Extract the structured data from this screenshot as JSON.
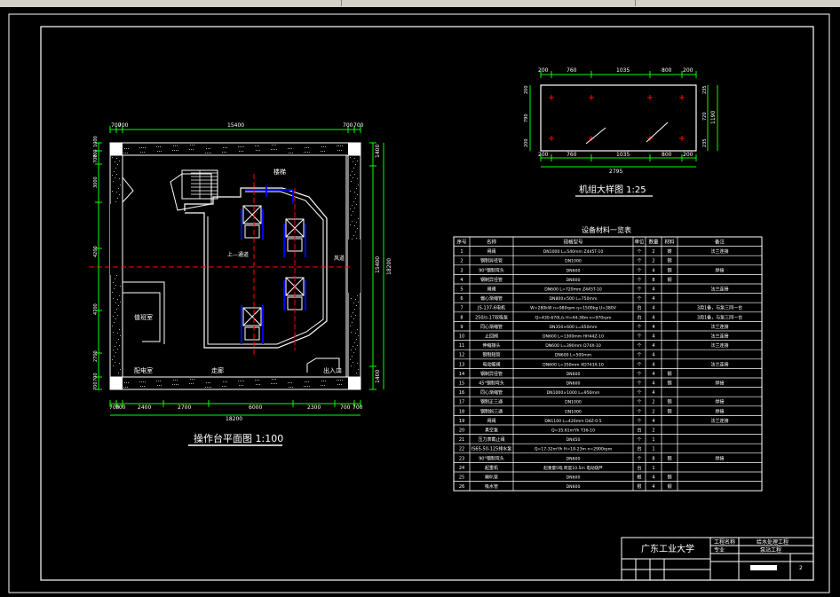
{
  "plan": {
    "title": "操作台平面图 1:100",
    "top_dims": [
      "700",
      "700",
      "15400",
      "700",
      "700"
    ],
    "bottom_dims": [
      "700",
      "700",
      "2400",
      "2700",
      "6000",
      "2300",
      "700",
      "700"
    ],
    "total_width": "18200",
    "left_dims": [
      "1000",
      "700",
      "700",
      "3000",
      "4200",
      "4700",
      "2700",
      "700",
      "700"
    ],
    "right_inner_dims": [
      "1400",
      "15400",
      "1400"
    ],
    "right_total": "18200",
    "labels": {
      "stairs": "楼梯",
      "trench": "上—通道",
      "duct": "风道",
      "pump_room": "值班室",
      "power_room": "配电室",
      "corridor": "走廊",
      "exit": "出入口"
    }
  },
  "unit": {
    "title": "机组大样图 1:25",
    "top_dims": [
      "200",
      "760",
      "1035",
      "800",
      "200"
    ],
    "bottom_dims": [
      "200",
      "760",
      "1035",
      "800",
      "200"
    ],
    "total": "2795",
    "right_dims": [
      "235",
      "720",
      "235"
    ],
    "right_total": "1190",
    "left_dims": [
      "200",
      "790",
      "200"
    ]
  },
  "table": {
    "title": "设备材料一览表",
    "headers": [
      "序号",
      "名称",
      "规格型号",
      "单位",
      "数量",
      "材料",
      "备注"
    ],
    "rows": [
      [
        "1",
        "闸阀",
        "DN1000 L=540mm Z445T-10",
        "个",
        "2",
        "铸",
        "法兰连接"
      ],
      [
        "2",
        "钢制异径管",
        "DN1000",
        "个",
        "2",
        "钢",
        ""
      ],
      [
        "3",
        "90°钢制弯头",
        "DN600",
        "个",
        "4",
        "钢",
        "焊接"
      ],
      [
        "4",
        "钢制异径管",
        "DN600",
        "个",
        "8",
        "钢",
        ""
      ],
      [
        "5",
        "闸阀",
        "DN600 L=720mm Z445T-10",
        "个",
        "4",
        "",
        "法兰连接"
      ],
      [
        "6",
        "偏心渐缩管",
        "DN800×500 L=750mm",
        "个",
        "4",
        "",
        ""
      ],
      [
        "7",
        "JS-137-6电机",
        "W=280kW n=980rpm η=1500kg U=380V",
        "台",
        "4",
        "",
        "3用1备，与泵三同一台"
      ],
      [
        "8",
        "250/s-17双吸泵",
        "Q=430-670L/s H=44-38m n=970rpm",
        "台",
        "4",
        "",
        "3用1备，与泵三同一台"
      ],
      [
        "9",
        "同心渐缩管",
        "DN350×600 L=650mm",
        "个",
        "4",
        "",
        "法兰连接"
      ],
      [
        "10",
        "止回阀",
        "DN600 L=1300mm HH44Z-10",
        "个",
        "4",
        "",
        "法兰连接"
      ],
      [
        "11",
        "伸缩接头",
        "DN600 L=390mm D74X-10",
        "个",
        "4",
        "",
        "法兰连接"
      ],
      [
        "12",
        "钢制短管",
        "DN600 L=500mm",
        "个",
        "4",
        "",
        ""
      ],
      [
        "13",
        "电动蝶阀",
        "DN600 L=350mm XD743X-10",
        "个",
        "4",
        "",
        "法兰连接"
      ],
      [
        "14",
        "钢制异径管",
        "DN600",
        "个",
        "4",
        "钢",
        ""
      ],
      [
        "15",
        "45°钢制弯头",
        "DN600",
        "个",
        "4",
        "钢",
        "焊接"
      ],
      [
        "16",
        "同心渐缩管",
        "DN1000×1000 L=950mm",
        "个",
        "4",
        "",
        ""
      ],
      [
        "17",
        "钢制正三通",
        "DN1000",
        "个",
        "2",
        "钢",
        "焊接"
      ],
      [
        "18",
        "钢制斜三通",
        "DN1000",
        "个",
        "2",
        "钢",
        "焊接"
      ],
      [
        "19",
        "闸阀",
        "DN1100 L=420mm D4Z-0.5",
        "个",
        "4",
        "",
        "法兰连接"
      ],
      [
        "20",
        "真空泵",
        "Q=35.61m³/h T36-10",
        "台",
        "2",
        "",
        ""
      ],
      [
        "21",
        "压力表截止阀",
        "DN450",
        "个",
        "1",
        "",
        ""
      ],
      [
        "22",
        "IS65-50-125排水泵",
        "Q=17-32m³/h H=18-23m n=2900rpm",
        "台",
        "1",
        "",
        ""
      ],
      [
        "23",
        "90°钢制弯头",
        "DN600",
        "个",
        "8",
        "钢",
        "焊接"
      ],
      [
        "24",
        "起重机",
        "起重量5吨 跨度10.5m 电动葫芦",
        "台",
        "1",
        "",
        ""
      ],
      [
        "25",
        "喇叭管",
        "DN600",
        "根",
        "4",
        "钢",
        ""
      ],
      [
        "26",
        "吸水管",
        "DN600",
        "根",
        "4",
        "钢",
        ""
      ]
    ]
  },
  "title_block": {
    "school": "广东工业大学",
    "label1": "工程名称",
    "label2": "专业",
    "project1": "给水处理工程",
    "project2": "泵站工程",
    "page": "2"
  },
  "colors": {
    "background": "#000000",
    "line": "#ffffff",
    "dimension": "#00ff00",
    "axis": "#ff0000",
    "pipe": "#0000ff",
    "hatch": "#aaaaaa"
  }
}
